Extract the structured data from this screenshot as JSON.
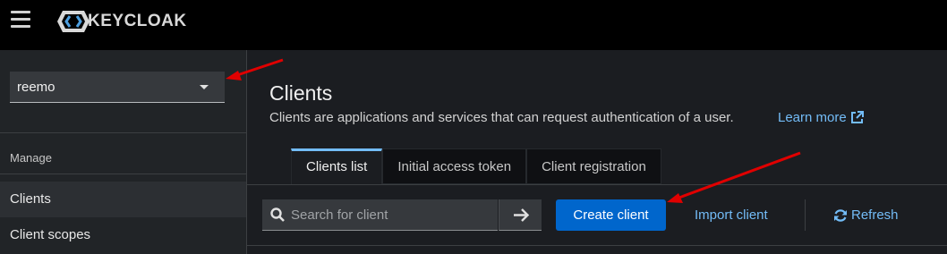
{
  "header": {
    "logo_text": "KEYCLOAK"
  },
  "sidebar": {
    "realm": "reemo",
    "section_heading": "Manage",
    "items": [
      {
        "label": "Clients"
      },
      {
        "label": "Client scopes"
      }
    ]
  },
  "main": {
    "title": "Clients",
    "description": "Clients are applications and services that can request authentication of a user.",
    "learn_more": "Learn more",
    "tabs": [
      {
        "label": "Clients list"
      },
      {
        "label": "Initial access token"
      },
      {
        "label": "Client registration"
      }
    ],
    "toolbar": {
      "search_placeholder": "Search for client",
      "create_label": "Create client",
      "import_label": "Import client",
      "refresh_label": "Refresh"
    }
  },
  "colors": {
    "accent": "#0066cc",
    "link": "#73bcf7",
    "annotation_arrow": "#e00000"
  }
}
